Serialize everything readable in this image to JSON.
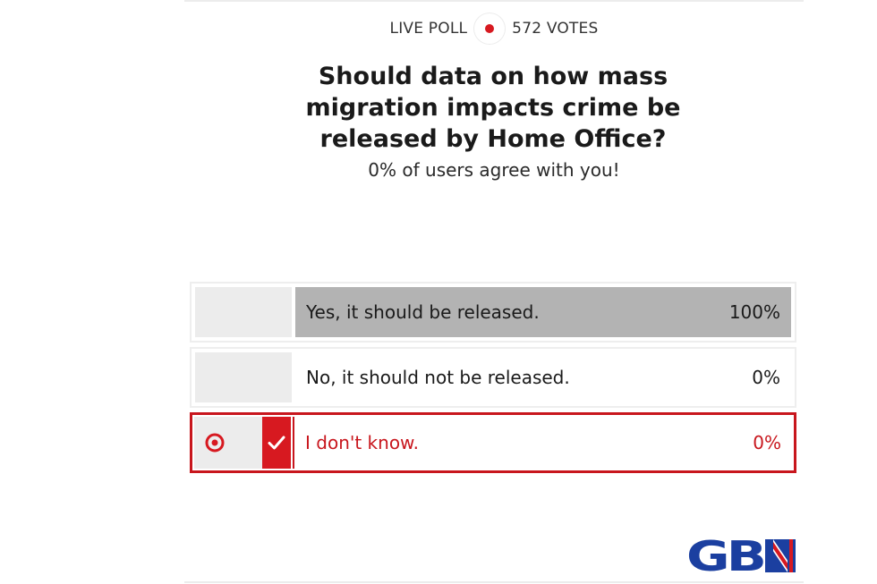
{
  "header": {
    "label": "LIVE POLL",
    "votes": "572 VOTES"
  },
  "question": "Should data on how mass migration impacts crime be released by Home Office?",
  "result_message": "0% of users agree with you!",
  "options": [
    {
      "label": "Yes, it should be released.",
      "percent_text": "100%",
      "share": 1.0,
      "selected": false
    },
    {
      "label": "No, it should not be released.",
      "percent_text": "0%",
      "share": 0.0,
      "selected": false
    },
    {
      "label": "I don't know.",
      "percent_text": "0%",
      "share": 0.0,
      "selected": true
    }
  ],
  "logo_text": "GBN",
  "colors": {
    "accent_red": "#d71920",
    "selected_border": "#c8161d",
    "result_bar": "#b3b3b3",
    "logo_blue": "#1b3fa0"
  },
  "icons": [
    "live-dot-icon",
    "target-icon",
    "checkmark-icon"
  ]
}
